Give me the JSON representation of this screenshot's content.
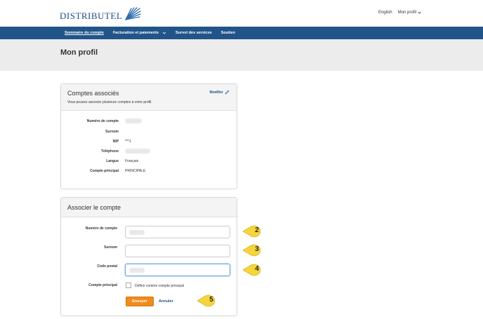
{
  "header": {
    "logo_text": "DISTRIBUTEL",
    "language_link": "English",
    "profile_menu": "Mon profil"
  },
  "nav": {
    "items": [
      {
        "label": "Sommaire du compte",
        "active": true
      },
      {
        "label": "Facturation et paiements",
        "dropdown": true
      },
      {
        "label": "Survol des services"
      },
      {
        "label": "Soutien"
      }
    ]
  },
  "page": {
    "title": "Mon profil"
  },
  "linked_accounts": {
    "title": "Comptes associés",
    "subtitle": "Vous pouvez associer plusieurs comptes à votre profil.",
    "edit_label": "Modifier",
    "rows": [
      {
        "label": "Numéro de compte",
        "value": ""
      },
      {
        "label": "Surnom",
        "value": ""
      },
      {
        "label": "NIP",
        "value": "***1"
      },
      {
        "label": "Téléphone",
        "value": ""
      },
      {
        "label": "Langue",
        "value": "Français"
      },
      {
        "label": "Compte principal",
        "value": "PRINCIPALE"
      }
    ]
  },
  "associate_form": {
    "title": "Associer le compte",
    "fields": [
      {
        "label": "Numéro de compte",
        "value": ""
      },
      {
        "label": "Surnom",
        "value": ""
      },
      {
        "label": "Code postal",
        "value": ""
      }
    ],
    "primary_label": "Compte principal",
    "checkbox_label": "Définir comme compte principal",
    "submit_label": "Envoyer",
    "cancel_label": "Annuler"
  },
  "callouts": [
    "2",
    "3",
    "4",
    "5"
  ],
  "colors": {
    "nav_bg": "#21558a",
    "hero_bg": "#ececec",
    "accent_button": "#f08b1d",
    "callout_fill": "#f5d53a",
    "link": "#21558a"
  }
}
